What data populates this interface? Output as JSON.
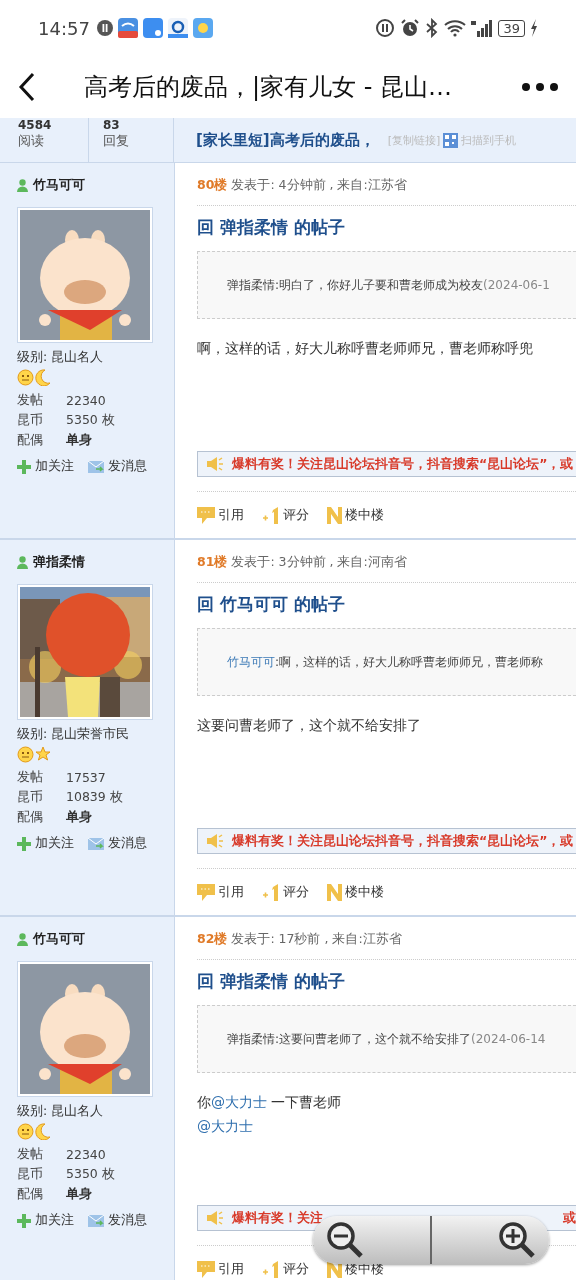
{
  "status_bar": {
    "time": "14:57",
    "battery": "39"
  },
  "nav": {
    "title": "高考后的废品，|家有儿女 - 昆山…"
  },
  "thread": {
    "views": "4584",
    "views_label": "阅读",
    "replies": "83",
    "replies_label": "回复",
    "title": "[家长里短]高考后的废品，",
    "copy_link": "[复制链接]",
    "scan": "扫描到手机"
  },
  "posts": [
    {
      "user": "竹马可可",
      "avatar": {
        "kind": "pig"
      },
      "level": "级别: 昆山名人",
      "medals": [
        {
          "kind": "smile"
        },
        {
          "kind": "moon"
        }
      ],
      "stats": [
        {
          "label": "发帖",
          "value": "22340"
        },
        {
          "label": "昆币",
          "value": "5350 枚"
        },
        {
          "label": "配偶",
          "value": "单身"
        }
      ],
      "follow": "加关注",
      "message": "发消息",
      "floor": "80楼",
      "meta": "发表于: 4分钟前 , 来自:江苏省",
      "reply_title": "回 弹指柔情 的帖子",
      "quote": {
        "author": "弹指柔情",
        "text": ":明白了，你好儿子要和曹老师成为校友",
        "date": "(2024-06-1",
        "author_link": false
      },
      "body": [
        [
          {
            "kind": "text",
            "text": "啊，这样的话，好大儿称呼曹老师师兄，曹老师称呼兜"
          }
        ]
      ],
      "banner": "爆料有奖！关注昆山论坛抖音号，抖音搜索“昆山论坛”，或",
      "actions": [
        "引用",
        "评分",
        "楼中楼"
      ]
    },
    {
      "user": "弹指柔情",
      "avatar": {
        "kind": "umbrella"
      },
      "level": "级别: 昆山荣誉市民",
      "medals": [
        {
          "kind": "smile"
        },
        {
          "kind": "star"
        }
      ],
      "stats": [
        {
          "label": "发帖",
          "value": "17537"
        },
        {
          "label": "昆币",
          "value": "10839 枚"
        },
        {
          "label": "配偶",
          "value": "单身"
        }
      ],
      "follow": "加关注",
      "message": "发消息",
      "floor": "81楼",
      "meta": "发表于: 3分钟前 , 来自:河南省",
      "reply_title": "回 竹马可可 的帖子",
      "quote": {
        "author": "竹马可可",
        "text": ":啊，这样的话，好大儿称呼曹老师师兄，曹老师称",
        "author_link": true
      },
      "body": [
        [
          {
            "kind": "text",
            "text": "这要问曹老师了，这个就不给安排了"
          }
        ]
      ],
      "banner": "爆料有奖！关注昆山论坛抖音号，抖音搜索“昆山论坛”，或",
      "actions": [
        "引用",
        "评分",
        "楼中楼"
      ]
    },
    {
      "user": "竹马可可",
      "avatar": {
        "kind": "pig"
      },
      "level": "级别: 昆山名人",
      "medals": [
        {
          "kind": "smile"
        },
        {
          "kind": "moon"
        }
      ],
      "stats": [
        {
          "label": "发帖",
          "value": "22340"
        },
        {
          "label": "昆币",
          "value": "5350 枚"
        },
        {
          "label": "配偶",
          "value": "单身"
        }
      ],
      "follow": "加关注",
      "message": "发消息",
      "floor": "82楼",
      "meta": "发表于: 17秒前 , 来自:江苏省",
      "reply_title": "回 弹指柔情 的帖子",
      "quote": {
        "author": "弹指柔情",
        "text": ":这要问曹老师了，这个就不给安排了",
        "date": "(2024-06-14",
        "author_link": false
      },
      "body": [
        [
          {
            "kind": "text",
            "text": "你"
          },
          {
            "kind": "mention",
            "text": "@大力士"
          },
          {
            "kind": "text",
            "text": "  一下曹老师"
          }
        ],
        [
          {
            "kind": "mention",
            "text": "@大力士"
          }
        ]
      ],
      "banner": "爆料有奖！关注",
      "banner_tail": "或",
      "actions": [
        "引用",
        "评分",
        "楼中楼"
      ]
    }
  ],
  "zoom_controls": {
    "visible": true
  }
}
